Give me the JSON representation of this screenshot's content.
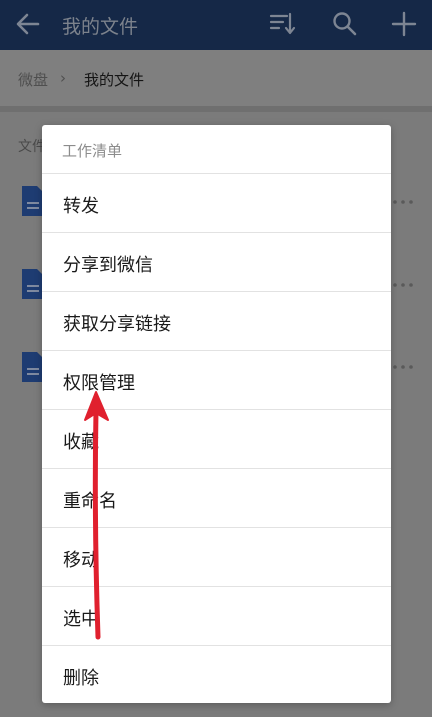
{
  "topbar": {
    "title": "我的文件",
    "icons": [
      "back-arrow-icon",
      "sort-icon",
      "search-icon",
      "plus-icon"
    ]
  },
  "breadcrumb": {
    "root": "微盘",
    "separator": "›",
    "current": "我的文件"
  },
  "list": {
    "label": "文件"
  },
  "menu": {
    "header": "工作清单",
    "items": [
      {
        "label": "转发"
      },
      {
        "label": "分享到微信"
      },
      {
        "label": "获取分享链接"
      },
      {
        "label": "权限管理"
      },
      {
        "label": "收藏"
      },
      {
        "label": "重命名"
      },
      {
        "label": "移动"
      },
      {
        "label": "选中"
      },
      {
        "label": "删除"
      }
    ]
  },
  "colors": {
    "topbar": "#152847",
    "file_icon": "#1e50a8",
    "annotation_arrow": "#e0202e"
  }
}
